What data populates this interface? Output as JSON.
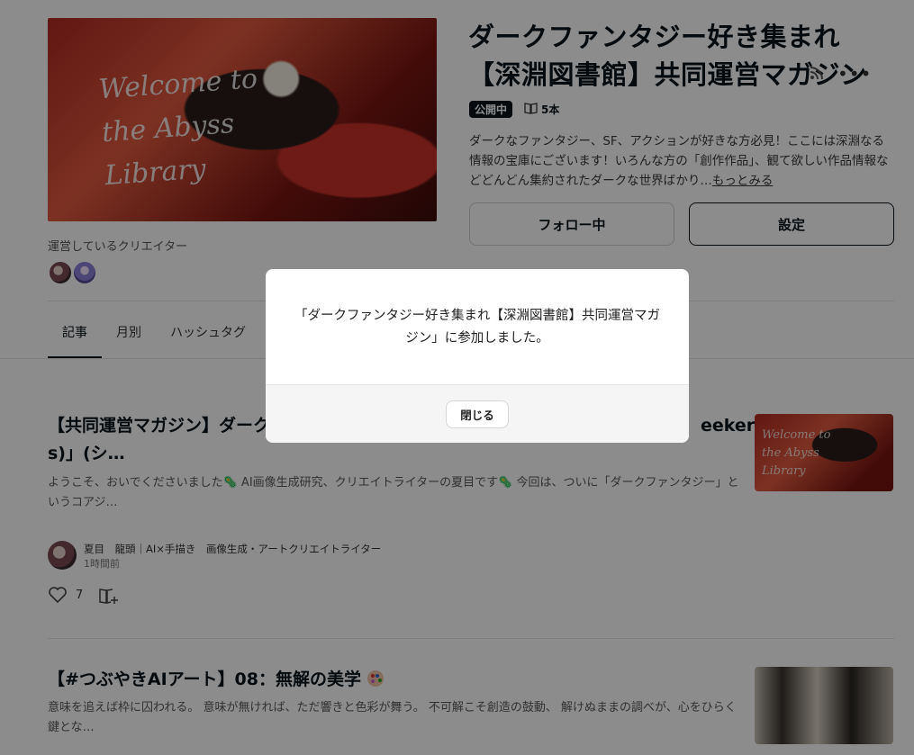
{
  "magazine": {
    "title": "ダークファンタジー好き集まれ【深淵図書館】共同運営マガジン",
    "status_badge": "公開中",
    "article_count": "5本",
    "description": "ダークなファンタジー、SF、アクションが好きな方必見！ここには深淵なる情報の宝庫にございます！いろんな方の「創作作品」、観て欲しい作品情報などどんどん集約されたダークな世界ばかり…",
    "more_link": "もっとみる",
    "follow_button": "フォロー中",
    "settings_button": "設定",
    "creators_label": "運営しているクリエイター",
    "hero_script": "Welcome to the Abyss Library"
  },
  "tabs": [
    {
      "label": "記事",
      "active": true
    },
    {
      "label": "月別",
      "active": false
    },
    {
      "label": "ハッシュタグ",
      "active": false
    }
  ],
  "articles": [
    {
      "title_start": "【共同運営マガジン】ダーク",
      "title_end": "eeker",
      "title_line2": "s)」(シ…",
      "excerpt": "ようこそ、おいでくださいました🦠 AI画像生成研究、クリエイトライターの夏目です🦠 今回は、ついに「ダークファンタジー」というコアジ…",
      "author": "夏目　龍頭｜AI×手描き　画像生成・アートクリエイトライター",
      "time": "1時間前",
      "likes": "7",
      "thumb_script": "Welcome to the Abyss Library"
    },
    {
      "title": "【#つぶやきAIアート】08：無解の美学",
      "excerpt": "意味を追えば枠に囚われる。 意味が無ければ、ただ響きと色彩が舞う。 不可解こそ創造の鼓動、 解けぬままの調べが、心をひらく鍵とな…"
    }
  ],
  "modal": {
    "message": "「ダークファンタジー好き集まれ【深淵図書館】共同運営マガジン」に参加しました。",
    "close_button": "閉じる"
  }
}
